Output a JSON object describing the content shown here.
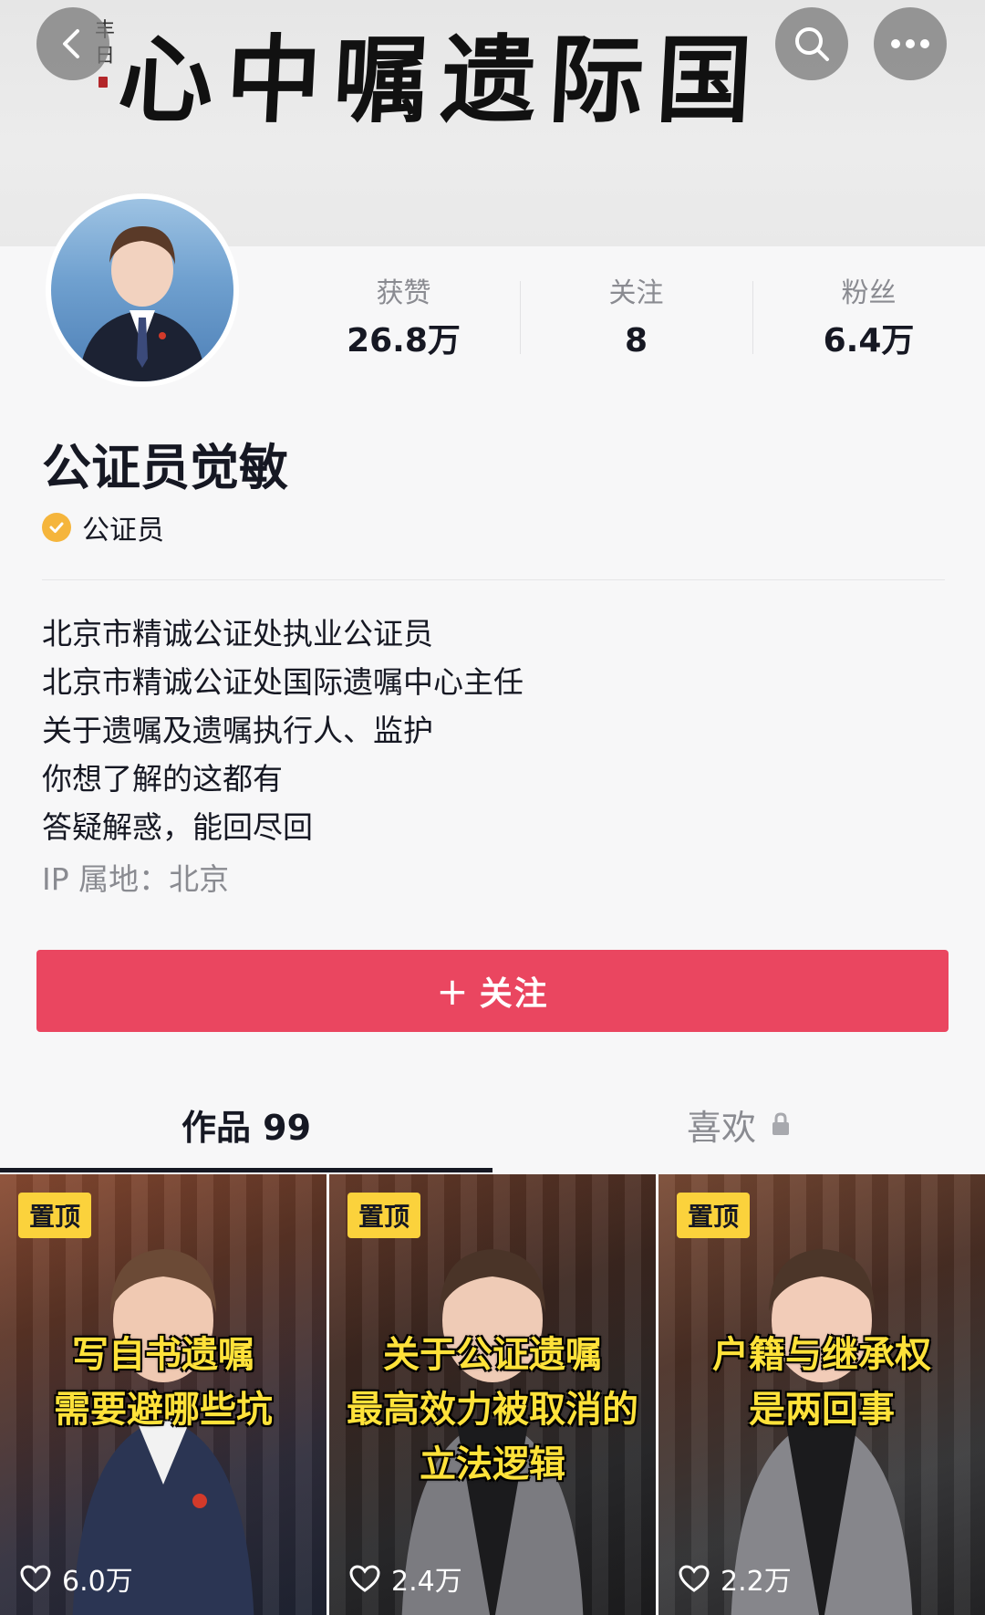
{
  "banner": {
    "calligraphy": "心中嘱遗际国",
    "seal_text": "丰日"
  },
  "header": {
    "back_icon": "chevron-left-icon",
    "search_icon": "search-icon",
    "more_icon": "more-horizontal-icon"
  },
  "profile": {
    "name": "公证员觉敏",
    "badge": "公证员",
    "stats": [
      {
        "label": "获赞",
        "value": "26.8万"
      },
      {
        "label": "关注",
        "value": "8"
      },
      {
        "label": "粉丝",
        "value": "6.4万"
      }
    ],
    "bio": [
      "北京市精诚公证处执业公证员",
      "北京市精诚公证处国际遗嘱中心主任",
      "关于遗嘱及遗嘱执行人、监护",
      "你想了解的这都有",
      "答疑解惑，能回尽回"
    ],
    "ip_location": "IP 属地：北京",
    "follow_label": "关注",
    "follow_color": "#ea4660"
  },
  "tabs": [
    {
      "label": "作品 99",
      "active": true
    },
    {
      "label": "喜欢",
      "active": false,
      "locked": true
    }
  ],
  "videos": [
    {
      "pinned_label": "置顶",
      "caption": [
        "写自书遗嘱",
        "需要避哪些坑"
      ],
      "likes": "6.0万"
    },
    {
      "pinned_label": "置顶",
      "caption": [
        "关于公证遗嘱",
        "最高效力被取消的",
        "立法逻辑"
      ],
      "likes": "2.4万"
    },
    {
      "pinned_label": "置顶",
      "caption": [
        "户籍与继承权",
        "是两回事"
      ],
      "likes": "2.2万"
    }
  ]
}
